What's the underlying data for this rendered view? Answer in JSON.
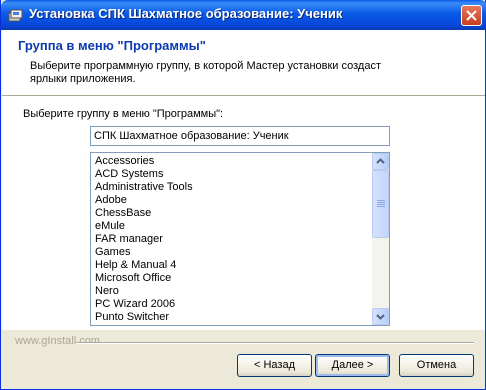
{
  "window": {
    "title": "Установка СПК Шахматное образование: Ученик"
  },
  "header": {
    "title": "Группа в меню \"Программы\"",
    "subtitle": "Выберите программную группу, в которой Мастер установки создаст ярлыки приложения."
  },
  "content": {
    "group_label": "Выберите группу в меню \"Программы\":",
    "group_value": "СПК Шахматное образование: Ученик",
    "list_items": [
      "Accessories",
      "ACD Systems",
      "Administrative Tools",
      "Adobe",
      "ChessBase",
      "eMule",
      "FAR manager",
      "Games",
      "Help & Manual 4",
      "Microsoft Office",
      "Nero",
      "PC Wizard 2006",
      "Punto Switcher"
    ]
  },
  "footer": {
    "brand": "www.gInstall.com",
    "back_label": "< Назад",
    "next_label": "Далее >",
    "cancel_label": "Отмена"
  }
}
